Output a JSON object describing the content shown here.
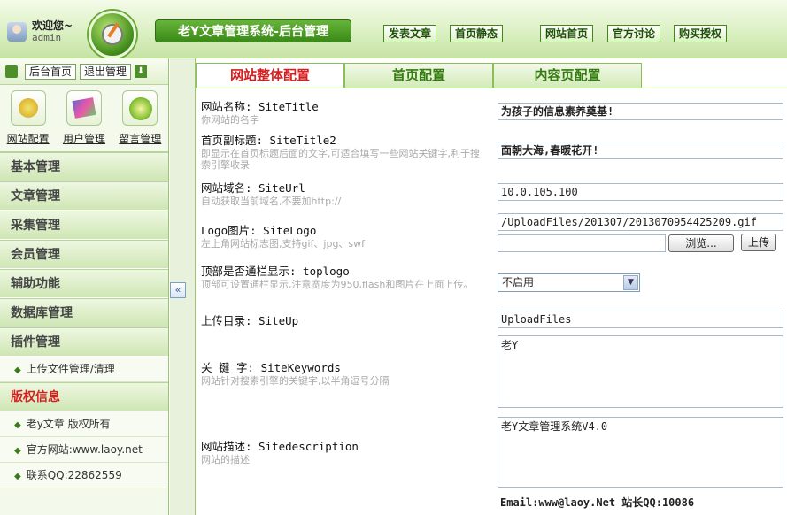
{
  "header": {
    "welcome": "欢迎您~",
    "username": "admin",
    "system_title": "老Y文章管理系统-后台管理",
    "buttons": [
      "发表文章",
      "首页静态",
      "网站首页",
      "官方讨论",
      "购买授权"
    ]
  },
  "sidebar": {
    "top_buttons": [
      "后台首页",
      "退出管理"
    ],
    "quick": [
      "网站配置",
      "用户管理",
      "留言管理"
    ],
    "menus": [
      "基本管理",
      "文章管理",
      "采集管理",
      "会员管理",
      "辅助功能",
      "数据库管理",
      "插件管理"
    ],
    "plugin_item": "上传文件管理/清理",
    "copyright_title": "版权信息",
    "copyright_items": [
      "老y文章 版权所有",
      "官方网站:www.laoy.net",
      "联系QQ:22862559"
    ]
  },
  "tabs": [
    "网站整体配置",
    "首页配置",
    "内容页配置"
  ],
  "form": {
    "site_title_label": "网站名称: SiteTitle",
    "site_title_hint": "你网站的名字",
    "site_title_value": "为孩子的信息素养奠基!",
    "site_title2_label": "首页副标题: SiteTitle2",
    "site_title2_hint": "即显示在首页标题后面的文字,可适合填写一些网站关键字,利于搜索引擎收录",
    "site_title2_value": "面朝大海,春暖花开!",
    "site_url_label": "网站域名: SiteUrl",
    "site_url_hint": "自动获取当前域名,不要加http://",
    "site_url_value": "10.0.105.100",
    "logo_label": "Logo图片: SiteLogo",
    "logo_hint": "左上角网站标志图,支持gif、jpg、swf",
    "logo_value": "/UploadFiles/201307/2013070954425209.gif",
    "browse_button": "浏览...",
    "upload_button": "上传",
    "toplogo_label": "顶部是否通栏显示: toplogo",
    "toplogo_hint": "顶部可设置通栏显示,注意宽度为950,flash和图片在上面上传。",
    "toplogo_value": "不启用",
    "siteup_label": "上传目录: SiteUp",
    "siteup_value": "UploadFiles",
    "keywords_label": "关 键 字: SiteKeywords",
    "keywords_hint": "网站针对搜索引擎的关键字,以半角逗号分隔",
    "keywords_value": "老Y",
    "desc_label": "网站描述: Sitedescription",
    "desc_hint": "网站的描述",
    "desc_value": "老Y文章管理系统V4.0",
    "email_value": "Email:www@laoy.Net 站长QQ:10086"
  },
  "icons": {
    "collapse": "«",
    "dropdown": "▼",
    "sub_arrow": "◆"
  }
}
